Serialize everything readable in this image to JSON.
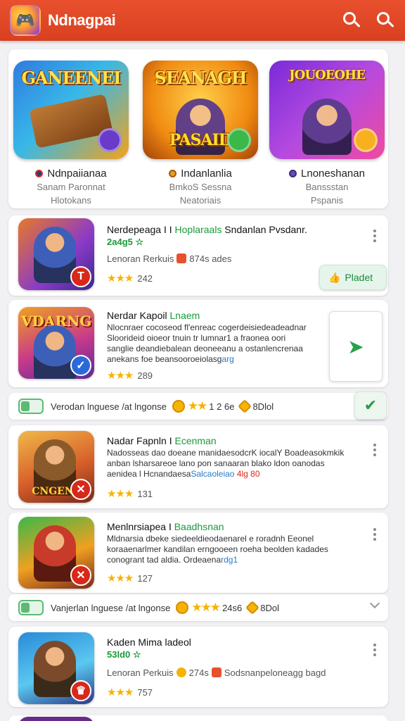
{
  "header": {
    "title": "Ndnagpai",
    "logo_icon": "game-logo",
    "icons": [
      "search-icon",
      "search-icon"
    ]
  },
  "featured": [
    {
      "banner": "GANEENEI",
      "title": "Ndnpaiianaa",
      "sub1": "Sanam Paronnat",
      "sub2": "Hlotokans",
      "colors": [
        "#2f7be0",
        "#f2a31a"
      ]
    },
    {
      "banner": "SEANAGH",
      "title": "Indanlanlia",
      "sub1": "BmkoS Sessna",
      "sub2": "Neatoriais",
      "colors": [
        "#f0a020",
        "#c45a10"
      ],
      "banner2": "PASAIII"
    },
    {
      "banner": "JOUOEOHE",
      "title": "Lnoneshanan",
      "sub1": "Banssstan",
      "sub2": "Pspanis",
      "colors": [
        "#8a3ad8",
        "#e04aa8"
      ]
    }
  ],
  "items": [
    {
      "title": "Nerdepeaga I I",
      "title_green": "Hoplaraals",
      "title_rest": "Sndanlan Pvsdanr.",
      "price": "2a4g5 ☆",
      "meta_a": "Lenoran Rerkuis",
      "meta_b": "874s ades",
      "rating": "242",
      "action": "Pladet",
      "thumb_label": "",
      "badge": "T"
    },
    {
      "title": "Nerdar Kapoil",
      "title_green": "Lnaem",
      "desc1": "Nlocnraer cocoseod fl'enreac cogerdeisiedeadeadnar",
      "desc2": "Sloorideid oioeor tnuin   tr lumnar1 a fraonea oori",
      "desc3": "sanglie deandiebalean deoneeanu a ostanlencrenaa",
      "desc4": "anekans foe beansooroeiolasg",
      "desc_hl": "arg",
      "rating": "289",
      "thumb_label": "VDARNG",
      "badge": "✓"
    },
    {
      "title": "Nadar Fapnln I",
      "title_green": "Ecenman",
      "desc1": "Nadosseas dao doeane manidaesodcrK iocalY Boadeasokmkik",
      "desc2": "anban lsharsareoe lano pon sanaaran blako ldon oanodas",
      "desc3": "aenidea l Hcnandaesa",
      "desc_hl": "Salcaoleiao",
      "desc_tail": "4lg 80",
      "rating": "131",
      "thumb_label": "CNGENS",
      "badge": "✕"
    },
    {
      "title": "Menlnrsiapea I",
      "title_green": "Baadhsnan",
      "desc1": "Mldnarsia dbeke siedeeldieodaenarel e roradnh Eeonel",
      "desc2": "koraaenarlmer kandilan erngooeen roeha beolden kadades",
      "desc3": "conogrant tad aldia. Ordeaena",
      "desc_hl": "rdg1",
      "rating": "127",
      "thumb_label": "",
      "badge": "✕"
    },
    {
      "title": "Kaden Mima ladeol",
      "price": "53ld0 ☆",
      "meta_a": "Lenoran Perkuis",
      "meta_b": "274s",
      "meta_c": "Sodsnanpeloneagg bagd",
      "rating": "757",
      "thumb_label": "",
      "badge": "♛"
    }
  ],
  "strips": [
    {
      "label": "Verodan lnguese /at lngonse",
      "value": "1 2 6e",
      "value2": "8Dlol"
    },
    {
      "label": "Vanjerlan lnguese /at lngonse",
      "value": "24s6",
      "value2": "8Dol"
    }
  ],
  "colors": {
    "header": "#e0482a",
    "accent_green": "#1a9a3a",
    "star": "#f5b400"
  }
}
